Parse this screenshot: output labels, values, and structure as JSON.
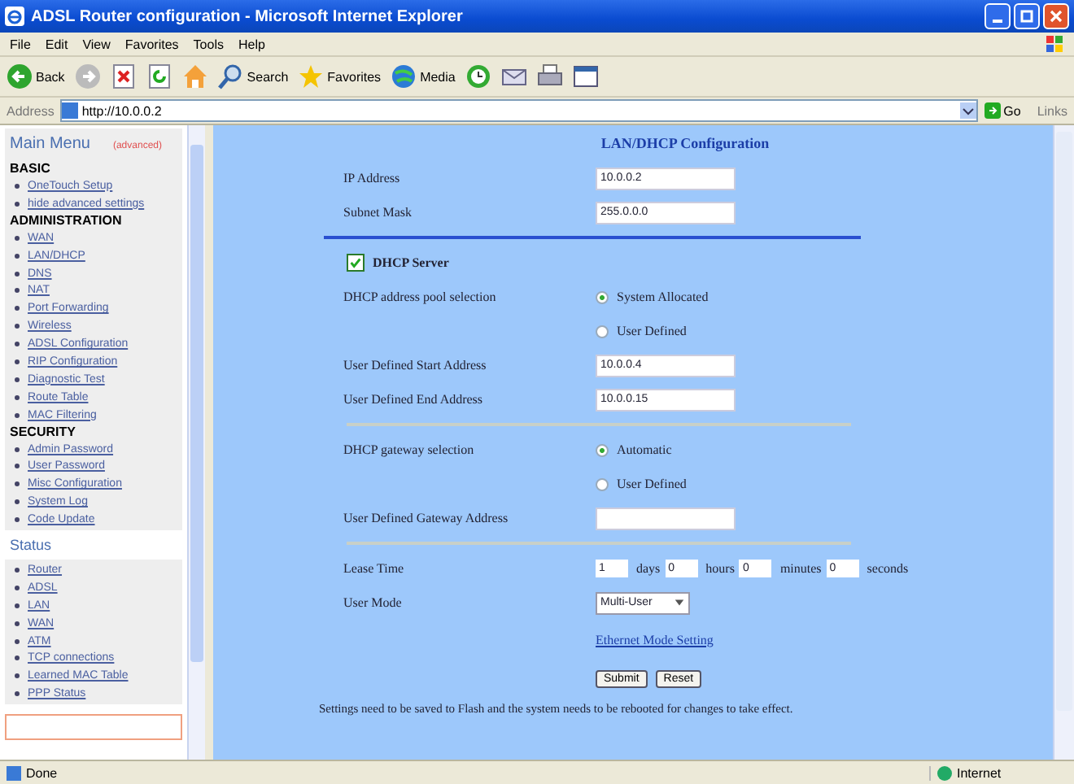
{
  "window": {
    "title": "ADSL Router configuration - Microsoft Internet Explorer"
  },
  "menu_bar": [
    "File",
    "Edit",
    "View",
    "Favorites",
    "Tools",
    "Help"
  ],
  "toolbar": [
    {
      "kind": "back",
      "label": "Back"
    },
    {
      "kind": "forward"
    },
    {
      "kind": "stop"
    },
    {
      "kind": "refresh"
    },
    {
      "kind": "home"
    },
    {
      "kind": "search",
      "label": "Search"
    },
    {
      "kind": "favorites",
      "label": "Favorites"
    },
    {
      "kind": "media",
      "label": "Media"
    },
    {
      "kind": "history"
    },
    {
      "kind": "mail"
    },
    {
      "kind": "print"
    },
    {
      "kind": "edit"
    }
  ],
  "address_bar": {
    "label": "Address",
    "value": "http://10.0.0.2",
    "go": "Go",
    "links": "Links"
  },
  "sidebar": {
    "title": "Main Menu",
    "note": "(advanced)",
    "sections": [
      {
        "heading": "BASIC",
        "items": [
          "OneTouch Setup",
          "hide advanced settings"
        ]
      },
      {
        "heading": "ADMINISTRATION",
        "items": [
          "WAN",
          "LAN/DHCP",
          "DNS",
          "NAT",
          "Port Forwarding",
          "Wireless",
          "ADSL Configuration",
          "RIP Configuration",
          "Diagnostic Test",
          "Route Table",
          "MAC Filtering"
        ]
      },
      {
        "heading": "SECURITY",
        "items": [
          "Admin Password",
          "User Password",
          "Misc Configuration",
          "System Log",
          "Code Update"
        ]
      }
    ],
    "status_title": "Status",
    "status_items": [
      "Router",
      "ADSL",
      "LAN",
      "WAN",
      "ATM",
      "TCP connections",
      "Learned MAC Table",
      "PPP Status"
    ]
  },
  "form": {
    "title": "LAN/DHCP Configuration",
    "ip_address": {
      "label": "IP Address",
      "value": "10.0.0.2"
    },
    "subnet_mask": {
      "label": "Subnet Mask",
      "value": "255.0.0.0"
    },
    "dhcp_server": {
      "label": "DHCP Server",
      "checked": true
    },
    "pool_selection": {
      "label": "DHCP address pool selection",
      "options": [
        {
          "label": "System Allocated",
          "selected": true
        },
        {
          "label": "User Defined",
          "selected": false
        }
      ]
    },
    "start_address": {
      "label": "User Defined Start Address",
      "value": "10.0.0.4"
    },
    "end_address": {
      "label": "User Defined End Address",
      "value": "10.0.0.15"
    },
    "gateway_selection": {
      "label": "DHCP gateway selection",
      "options": [
        {
          "label": "Automatic",
          "selected": true
        },
        {
          "label": "User Defined",
          "selected": false
        }
      ]
    },
    "gateway_address": {
      "label": "User Defined Gateway Address"
    },
    "lease_time": {
      "label": "Lease Time",
      "parts": [
        {
          "value": "1",
          "unit": "days"
        },
        {
          "value": "0",
          "unit": "hours"
        },
        {
          "value": "0",
          "unit": "minutes"
        },
        {
          "value": "0",
          "unit": "seconds"
        }
      ]
    },
    "user_mode": {
      "label": "User Mode",
      "value": "Multi-User"
    },
    "link": "Ethernet Mode Setting",
    "buttons": [
      "Submit",
      "Reset"
    ],
    "note": "Settings need to be saved to Flash and the system needs to be rebooted for changes to take effect."
  },
  "status_bar": {
    "text": "Done",
    "zone": "Internet"
  }
}
